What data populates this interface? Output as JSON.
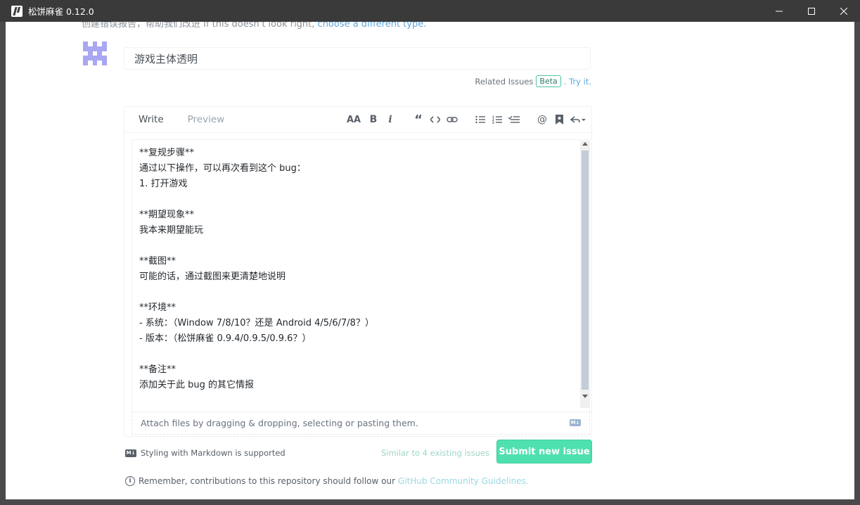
{
  "window": {
    "title": "松饼麻雀 0.12.0"
  },
  "hint": {
    "text": "创建错误报告，帮助我们改进 If this doesn't look right,",
    "link": "choose a different type."
  },
  "issue": {
    "title_value": "游戏主体透明"
  },
  "related": {
    "label": "Related Issues",
    "badge": "Beta",
    "suffix": ". Try it."
  },
  "editor": {
    "tabs": [
      {
        "label": "Write",
        "active": true
      },
      {
        "label": "Preview",
        "active": false
      }
    ],
    "toolbar": [
      "heading-icon",
      "bold-icon",
      "italic-icon",
      "quote-icon",
      "code-icon",
      "link-icon",
      "bulleted-list-icon",
      "numbered-list-icon",
      "task-list-icon",
      "mention-icon",
      "saved-reply-icon",
      "reply-icon"
    ],
    "body": "**复规步骤**\n通过以下操作，可以再次看到这个 bug：\n1. 打开游戏\n\n**期望现象**\n我本来期望能玩\n\n**截图**\n可能的话，通过截图来更清楚地说明\n\n**环境**\n- 系统：（Window 7/8/10？还是 Android 4/5/6/7/8？）\n- 版本：（松饼麻雀 0.9.4/0.9.5/0.9.6？）\n\n**备注**\n添加关于此 bug 的其它情报",
    "attach_text": "Attach files by dragging & dropping, selecting or pasting them."
  },
  "footer": {
    "markdown_note": "Styling with Markdown is supported",
    "similar": "Similar to 4 existing issues",
    "submit_label": "Submit new issue"
  },
  "remember": {
    "text": "Remember, contributions to this repository should follow our",
    "link": "GitHub Community Guidelines."
  },
  "colors": {
    "titlebar": "#3a3a3a",
    "submit": "#4fe0b0",
    "link": "#5fa8d9"
  }
}
